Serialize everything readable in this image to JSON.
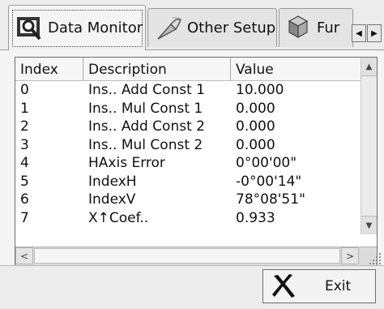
{
  "tabs": [
    {
      "label": "Data Monitor",
      "icon": "data-monitor-icon",
      "active": true
    },
    {
      "label": "Other Setup",
      "icon": "satellite-dish-icon",
      "active": false
    },
    {
      "label": "Fur",
      "icon": "function-blocks-icon",
      "active": false
    }
  ],
  "tab_scroll": {
    "left": "◀",
    "right": "▶"
  },
  "table": {
    "columns": [
      "Index",
      "Description",
      "Value"
    ],
    "rows": [
      {
        "index": "0",
        "description": "Ins.. Add Const 1",
        "value": "10.000"
      },
      {
        "index": "1",
        "description": "Ins.. Mul Const 1",
        "value": "0.000"
      },
      {
        "index": "2",
        "description": "Ins.. Add Const 2",
        "value": "0.000"
      },
      {
        "index": "3",
        "description": "Ins.. Mul Const 2",
        "value": "0.000"
      },
      {
        "index": "4",
        "description": "HAxis Error",
        "value": "0°00'00\""
      },
      {
        "index": "5",
        "description": "IndexH",
        "value": "-0°00'14\""
      },
      {
        "index": "6",
        "description": "IndexV",
        "value": "78°08'51\""
      },
      {
        "index": "7",
        "description": "X↑Coef..",
        "value": "0.933"
      }
    ]
  },
  "scroll_arrows": {
    "up": "▲",
    "down": "▼",
    "left": "<",
    "right": ">"
  },
  "exit_button": {
    "label": "Exit",
    "icon": "exit-x-icon"
  }
}
